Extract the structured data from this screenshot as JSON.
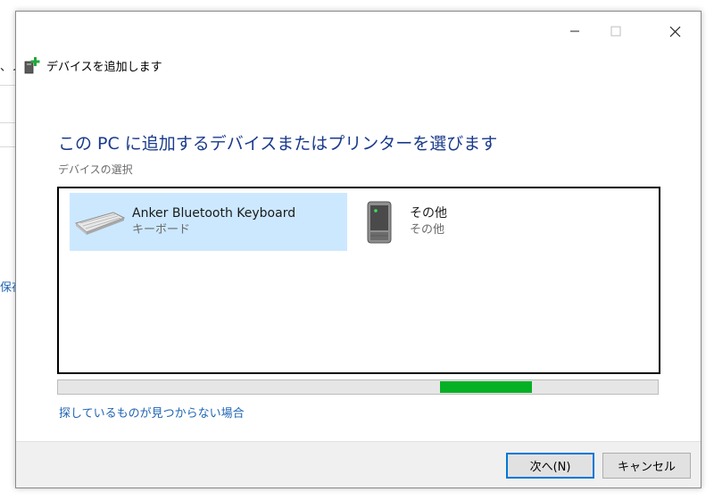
{
  "background_window": {
    "text_top": "、ノ",
    "text_middle": "保存"
  },
  "dialog": {
    "title": "デバイスを追加します",
    "heading": "この PC に追加するデバイスまたはプリンターを選びます",
    "subheading": "デバイスの選択",
    "devices": [
      {
        "name": "Anker Bluetooth Keyboard",
        "type": "キーボード",
        "icon": "keyboard-icon",
        "selected": true
      },
      {
        "name": "その他",
        "type": "その他",
        "icon": "computer-tower-icon",
        "selected": false
      }
    ],
    "progress": {
      "indeterminate": true,
      "color": "#06b025"
    },
    "help_link": "探しているものが見つからない場合",
    "buttons": {
      "next": "次へ(N)",
      "cancel": "キャンセル"
    }
  },
  "colors": {
    "accent": "#0078d7",
    "heading": "#1a3a8c",
    "link": "#1f64b5",
    "selection": "#cce8ff"
  }
}
